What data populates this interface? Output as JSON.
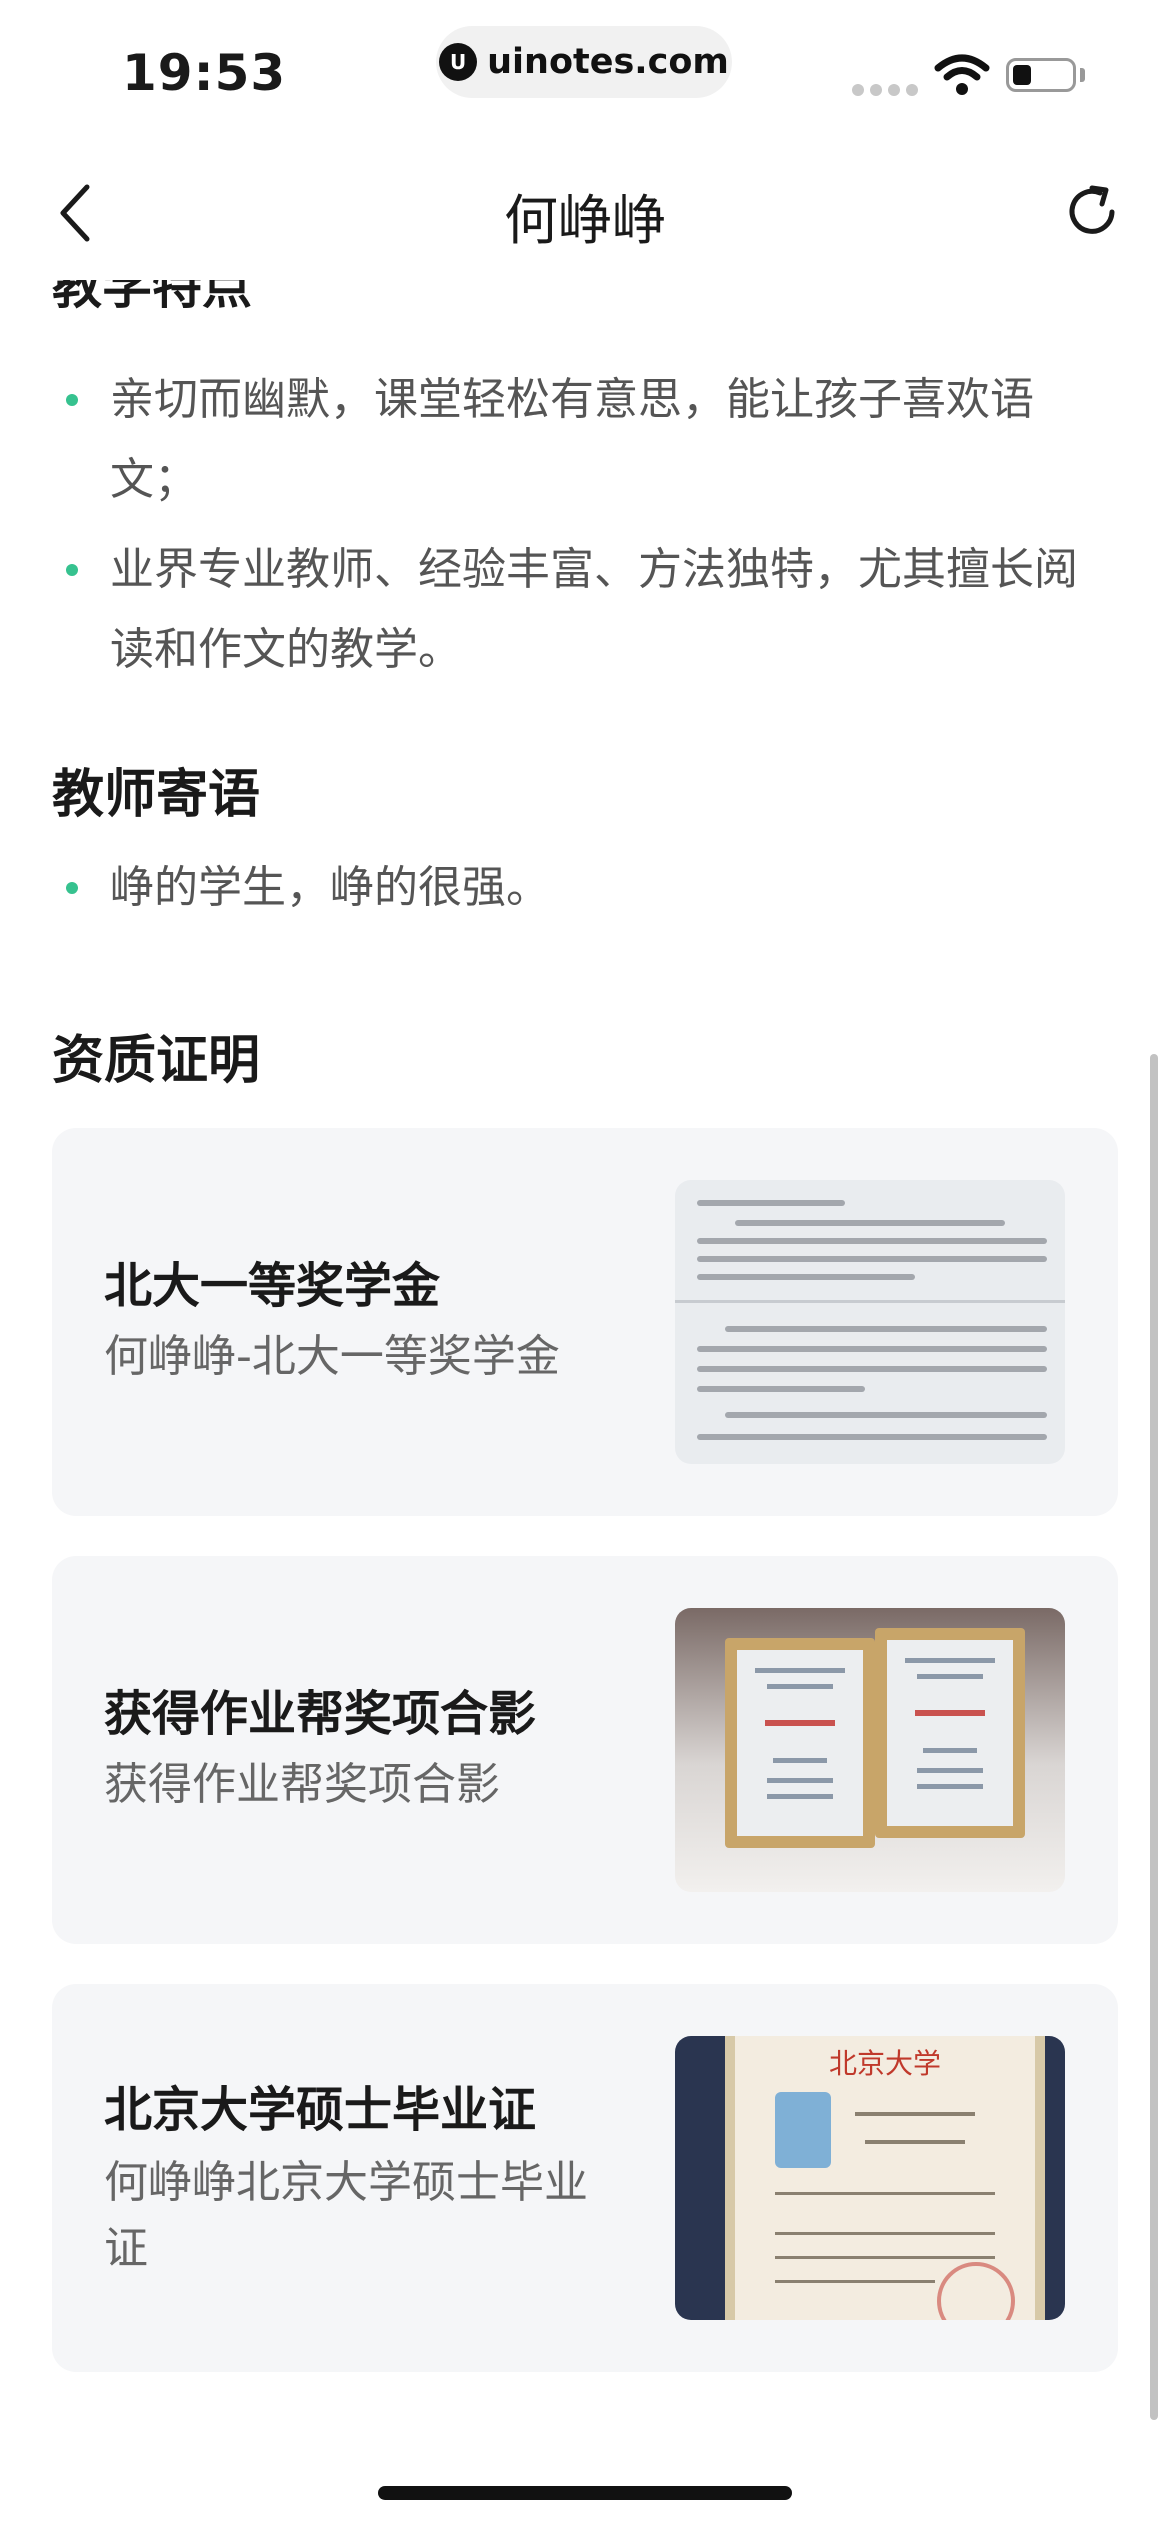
{
  "status_bar": {
    "time": "19:53",
    "url": "uinotes.com",
    "url_logo_glyph": "U"
  },
  "nav": {
    "title": "何峥峥",
    "back_icon": "chevron-left-icon",
    "refresh_icon": "refresh-icon"
  },
  "teaching_features": {
    "heading": "教学特点",
    "items": [
      "亲切而幽默，课堂轻松有意思，能让孩子喜欢语文；",
      "业界专业教师、经验丰富、方法独特，尤其擅长阅读和作文的教学。"
    ]
  },
  "teacher_message": {
    "heading": "教师寄语",
    "items": [
      "峥的学生，峥的很强。"
    ]
  },
  "certificates": {
    "heading": "资质证明",
    "items": [
      {
        "title": "北大一等奖学金",
        "subtitle": "何峥峥-北大一等奖学金"
      },
      {
        "title": "获得作业帮奖项合影",
        "subtitle": "获得作业帮奖项合影"
      },
      {
        "title": "北京大学硕士毕业证",
        "subtitle": "何峥峥北京大学硕士毕业证"
      }
    ]
  },
  "diploma_image": {
    "header": "北京大学"
  },
  "colors": {
    "accent_green": "#36c28f",
    "card_bg": "#f5f6f8",
    "text_primary": "#1a1a1a",
    "text_secondary": "#666666"
  }
}
